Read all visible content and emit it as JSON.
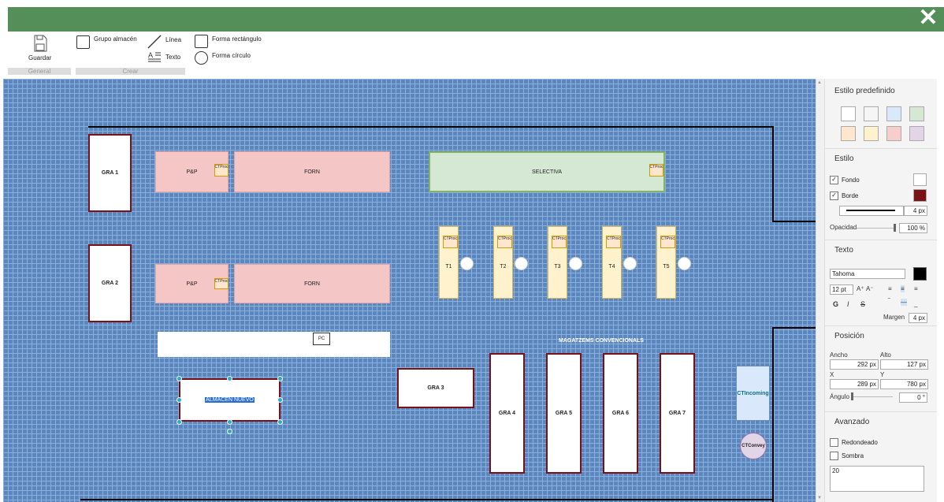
{
  "window": {
    "close_glyph": "✕"
  },
  "ribbon": {
    "save_label": "Guardar",
    "group_general": "General",
    "group_create": "Crear",
    "grupo_almacen": "Grupo almacén",
    "linea": "Línea",
    "texto": "Texto",
    "forma_rect": "Forma rectángulo",
    "forma_circ": "Forma círculo"
  },
  "canvas": {
    "gra1": "GRA 1",
    "gra2": "GRA 2",
    "gra3": "GRA 3",
    "gra4": "GRA 4",
    "gra5": "GRA 5",
    "gra6": "GRA 6",
    "gra7": "GRA 7",
    "pp1": "P&P",
    "pp2": "P&P",
    "forn1": "FORN",
    "forn2": "FORN",
    "selectiva": "SELECTIVA",
    "ctproc": "CTProc",
    "t1": "T1",
    "t2": "T2",
    "t3": "T3",
    "t4": "T4",
    "t5": "T5",
    "pc": "PC",
    "almacen_nuevo": "ALMACÉN NUEVO",
    "magatzems": "MAGATZEMS CONVENCIONALS",
    "ctincoming": "CTIncoming",
    "ctconvey": "CTConvey"
  },
  "panel": {
    "estilo_predefinido": "Estilo predefinido",
    "swatches": [
      "#ffffff",
      "#f5f5f5",
      "#dae8fc",
      "#d5e8d4",
      "#ffe6cc",
      "#fff2cc",
      "#f8cecc",
      "#e1d5e7"
    ],
    "estilo": "Estilo",
    "fondo": "Fondo",
    "fondo_color": "#ffffff",
    "borde": "Borde",
    "borde_color": "#7a1116",
    "line_width": "4 px",
    "opacidad": "Opacidad",
    "opacidad_value": "100 %",
    "texto": "Texto",
    "font": "Tahoma",
    "font_size": "12 pt",
    "bold": "G",
    "italic": "I",
    "strike": "S",
    "margen": "Margen",
    "margen_value": "4 px",
    "posicion": "Posición",
    "ancho": "Ancho",
    "alto": "Alto",
    "ancho_value": "292 px",
    "alto_value": "127 px",
    "x": "X",
    "y": "Y",
    "x_value": "289 px",
    "y_value": "780 px",
    "angulo": "Ángulo",
    "angulo_value": "0 °",
    "avanzado": "Avanzado",
    "redondeado": "Redondeado",
    "sombra": "Sombra",
    "textarea_value": "20"
  }
}
